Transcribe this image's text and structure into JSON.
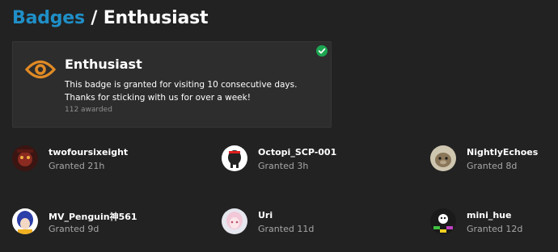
{
  "breadcrumb": {
    "parent": "Badges",
    "separator": "/",
    "current": "Enthusiast"
  },
  "badge": {
    "icon": "eye-icon",
    "icon_color": "#e08a25",
    "name": "Enthusiast",
    "description": "This badge is granted for visiting 10 consecutive days. Thanks for sticking with us for over a week!",
    "awarded": "112 awarded",
    "status_icon": "check-circle-icon",
    "status_color": "#1ca551"
  },
  "grants": [
    {
      "username": "twofoursixeight",
      "granted": "Granted 21h"
    },
    {
      "username": "Octopi_SCP-001",
      "granted": "Granted 3h"
    },
    {
      "username": "NightlyEchoes",
      "granted": "Granted 8d"
    },
    {
      "username": "MV_Penguin神561",
      "granted": "Granted 9d"
    },
    {
      "username": "Uri",
      "granted": "Granted 11d"
    },
    {
      "username": "mini_hue",
      "granted": "Granted 12d"
    }
  ],
  "colors": {
    "background": "#222222",
    "link": "#1f8fc7",
    "card": "#2d2d2d"
  }
}
